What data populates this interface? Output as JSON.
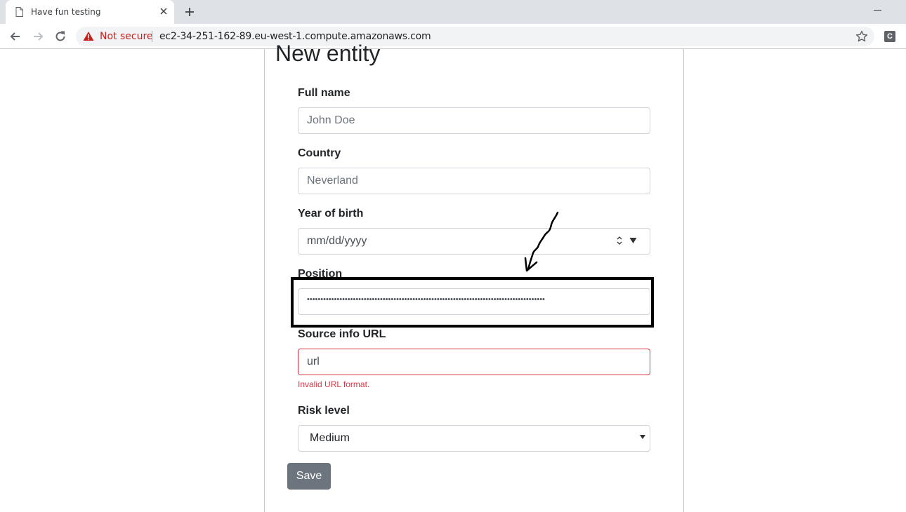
{
  "browser": {
    "tab_title": "Have fun testing",
    "security_label": "Not secure",
    "url": "ec2-34-251-162-89.eu-west-1.compute.amazonaws.com",
    "extension_letter": "C"
  },
  "page": {
    "title": "New entity"
  },
  "form": {
    "full_name": {
      "label": "Full name",
      "placeholder": "John Doe"
    },
    "country": {
      "label": "Country",
      "placeholder": "Neverland"
    },
    "year_of_birth": {
      "label": "Year of birth",
      "placeholder": "mm/dd/yyyy"
    },
    "position": {
      "label": "Position",
      "value_masked": "••••••••••••••••••••••••••••••••••••••••••••••••••••••••••••••••••••••••••••••••••••••••"
    },
    "source_url": {
      "label": "Source info URL",
      "value": "url",
      "error": "Invalid URL format."
    },
    "risk_level": {
      "label": "Risk level",
      "selected": "Medium"
    },
    "save_label": "Save"
  },
  "colors": {
    "error": "#dc3545",
    "button": "#6c757d",
    "not_secure": "#c5221f"
  }
}
